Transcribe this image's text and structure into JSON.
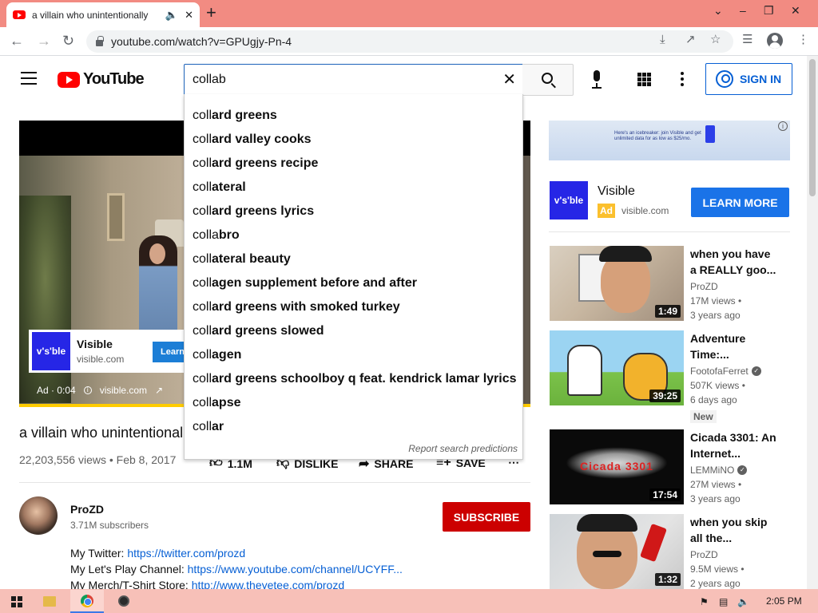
{
  "browser": {
    "tab_title": "a villain who unintentionally",
    "url": "youtube.com/watch?v=GPUgjy-Pn-4"
  },
  "header": {
    "logo_text": "YouTube",
    "search_value": "collab",
    "sign_in_label": "SIGN IN"
  },
  "suggestions": {
    "items": [
      {
        "typed": "coll",
        "rest": "ard greens"
      },
      {
        "typed": "coll",
        "rest": "ard valley cooks"
      },
      {
        "typed": "coll",
        "rest": "ard greens recipe"
      },
      {
        "typed": "coll",
        "rest": "ateral"
      },
      {
        "typed": "coll",
        "rest": "ard greens lyrics"
      },
      {
        "typed": "colla",
        "rest": "bro"
      },
      {
        "typed": "coll",
        "rest": "ateral beauty"
      },
      {
        "typed": "coll",
        "rest": "agen supplement before and after"
      },
      {
        "typed": "coll",
        "rest": "ard greens with smoked turkey"
      },
      {
        "typed": "coll",
        "rest": "ard greens slowed"
      },
      {
        "typed": "coll",
        "rest": "agen"
      },
      {
        "typed": "coll",
        "rest": "ard greens schoolboy q feat. kendrick lamar lyrics"
      },
      {
        "typed": "coll",
        "rest": "apse"
      },
      {
        "typed": "coll",
        "rest": "ar"
      }
    ],
    "report_label": "Report search predictions"
  },
  "player": {
    "ad_logo": "v's'ble",
    "ad_name": "Visible",
    "ad_url": "visible.com",
    "ad_learn": "Learn m",
    "ad_label": "Ad · 0:04",
    "ad_domain": "visible.com"
  },
  "video": {
    "title": "a villain who unintentional",
    "meta": "22,203,556 views • Feb 8, 2017",
    "likes": "1.1M",
    "dislike_label": "DISLIKE",
    "share_label": "SHARE",
    "save_label": "SAVE"
  },
  "channel": {
    "name": "ProZD",
    "subscribers": "3.71M subscribers",
    "subscribe_label": "SUBSCRIBE"
  },
  "description": [
    {
      "label": "My Twitter: ",
      "link": "https://twitter.com/prozd"
    },
    {
      "label": "My Let's Play Channel: ",
      "link": "https://www.youtube.com/channel/UCYFF..."
    },
    {
      "label": "My Merch/T-Shirt Store: ",
      "link": "http://www.theyetee.com/prozd"
    }
  ],
  "sidebar_ad": {
    "banner_text": "Here's an icebreaker: join Visible and get unlimited data for as low as $25/mo.",
    "logo": "v's'ble",
    "name": "Visible",
    "badge": "Ad",
    "url": "visible.com",
    "cta": "LEARN MORE"
  },
  "recommendations": [
    {
      "title": "when you have a REALLY goo...",
      "channel": "ProZD",
      "verified": false,
      "views": "17M views •",
      "age": "3 years ago",
      "duration": "1:49",
      "new": ""
    },
    {
      "title": "Adventure Time:...",
      "channel": "FootofaFerret",
      "verified": true,
      "views": "507K views •",
      "age": "6 days ago",
      "duration": "39:25",
      "new": "New"
    },
    {
      "title": "Cicada 3301: An Internet...",
      "channel": "LEMMiNO",
      "verified": true,
      "views": "27M views •",
      "age": "3 years ago",
      "duration": "17:54",
      "new": ""
    },
    {
      "title": "when you skip all the...",
      "channel": "ProZD",
      "verified": false,
      "views": "9.5M views •",
      "age": "2 years ago",
      "duration": "1:32",
      "new": ""
    }
  ],
  "thumb_art": {
    "cicada_text": "Cicada 3301"
  },
  "taskbar": {
    "clock": "2:05 PM"
  }
}
